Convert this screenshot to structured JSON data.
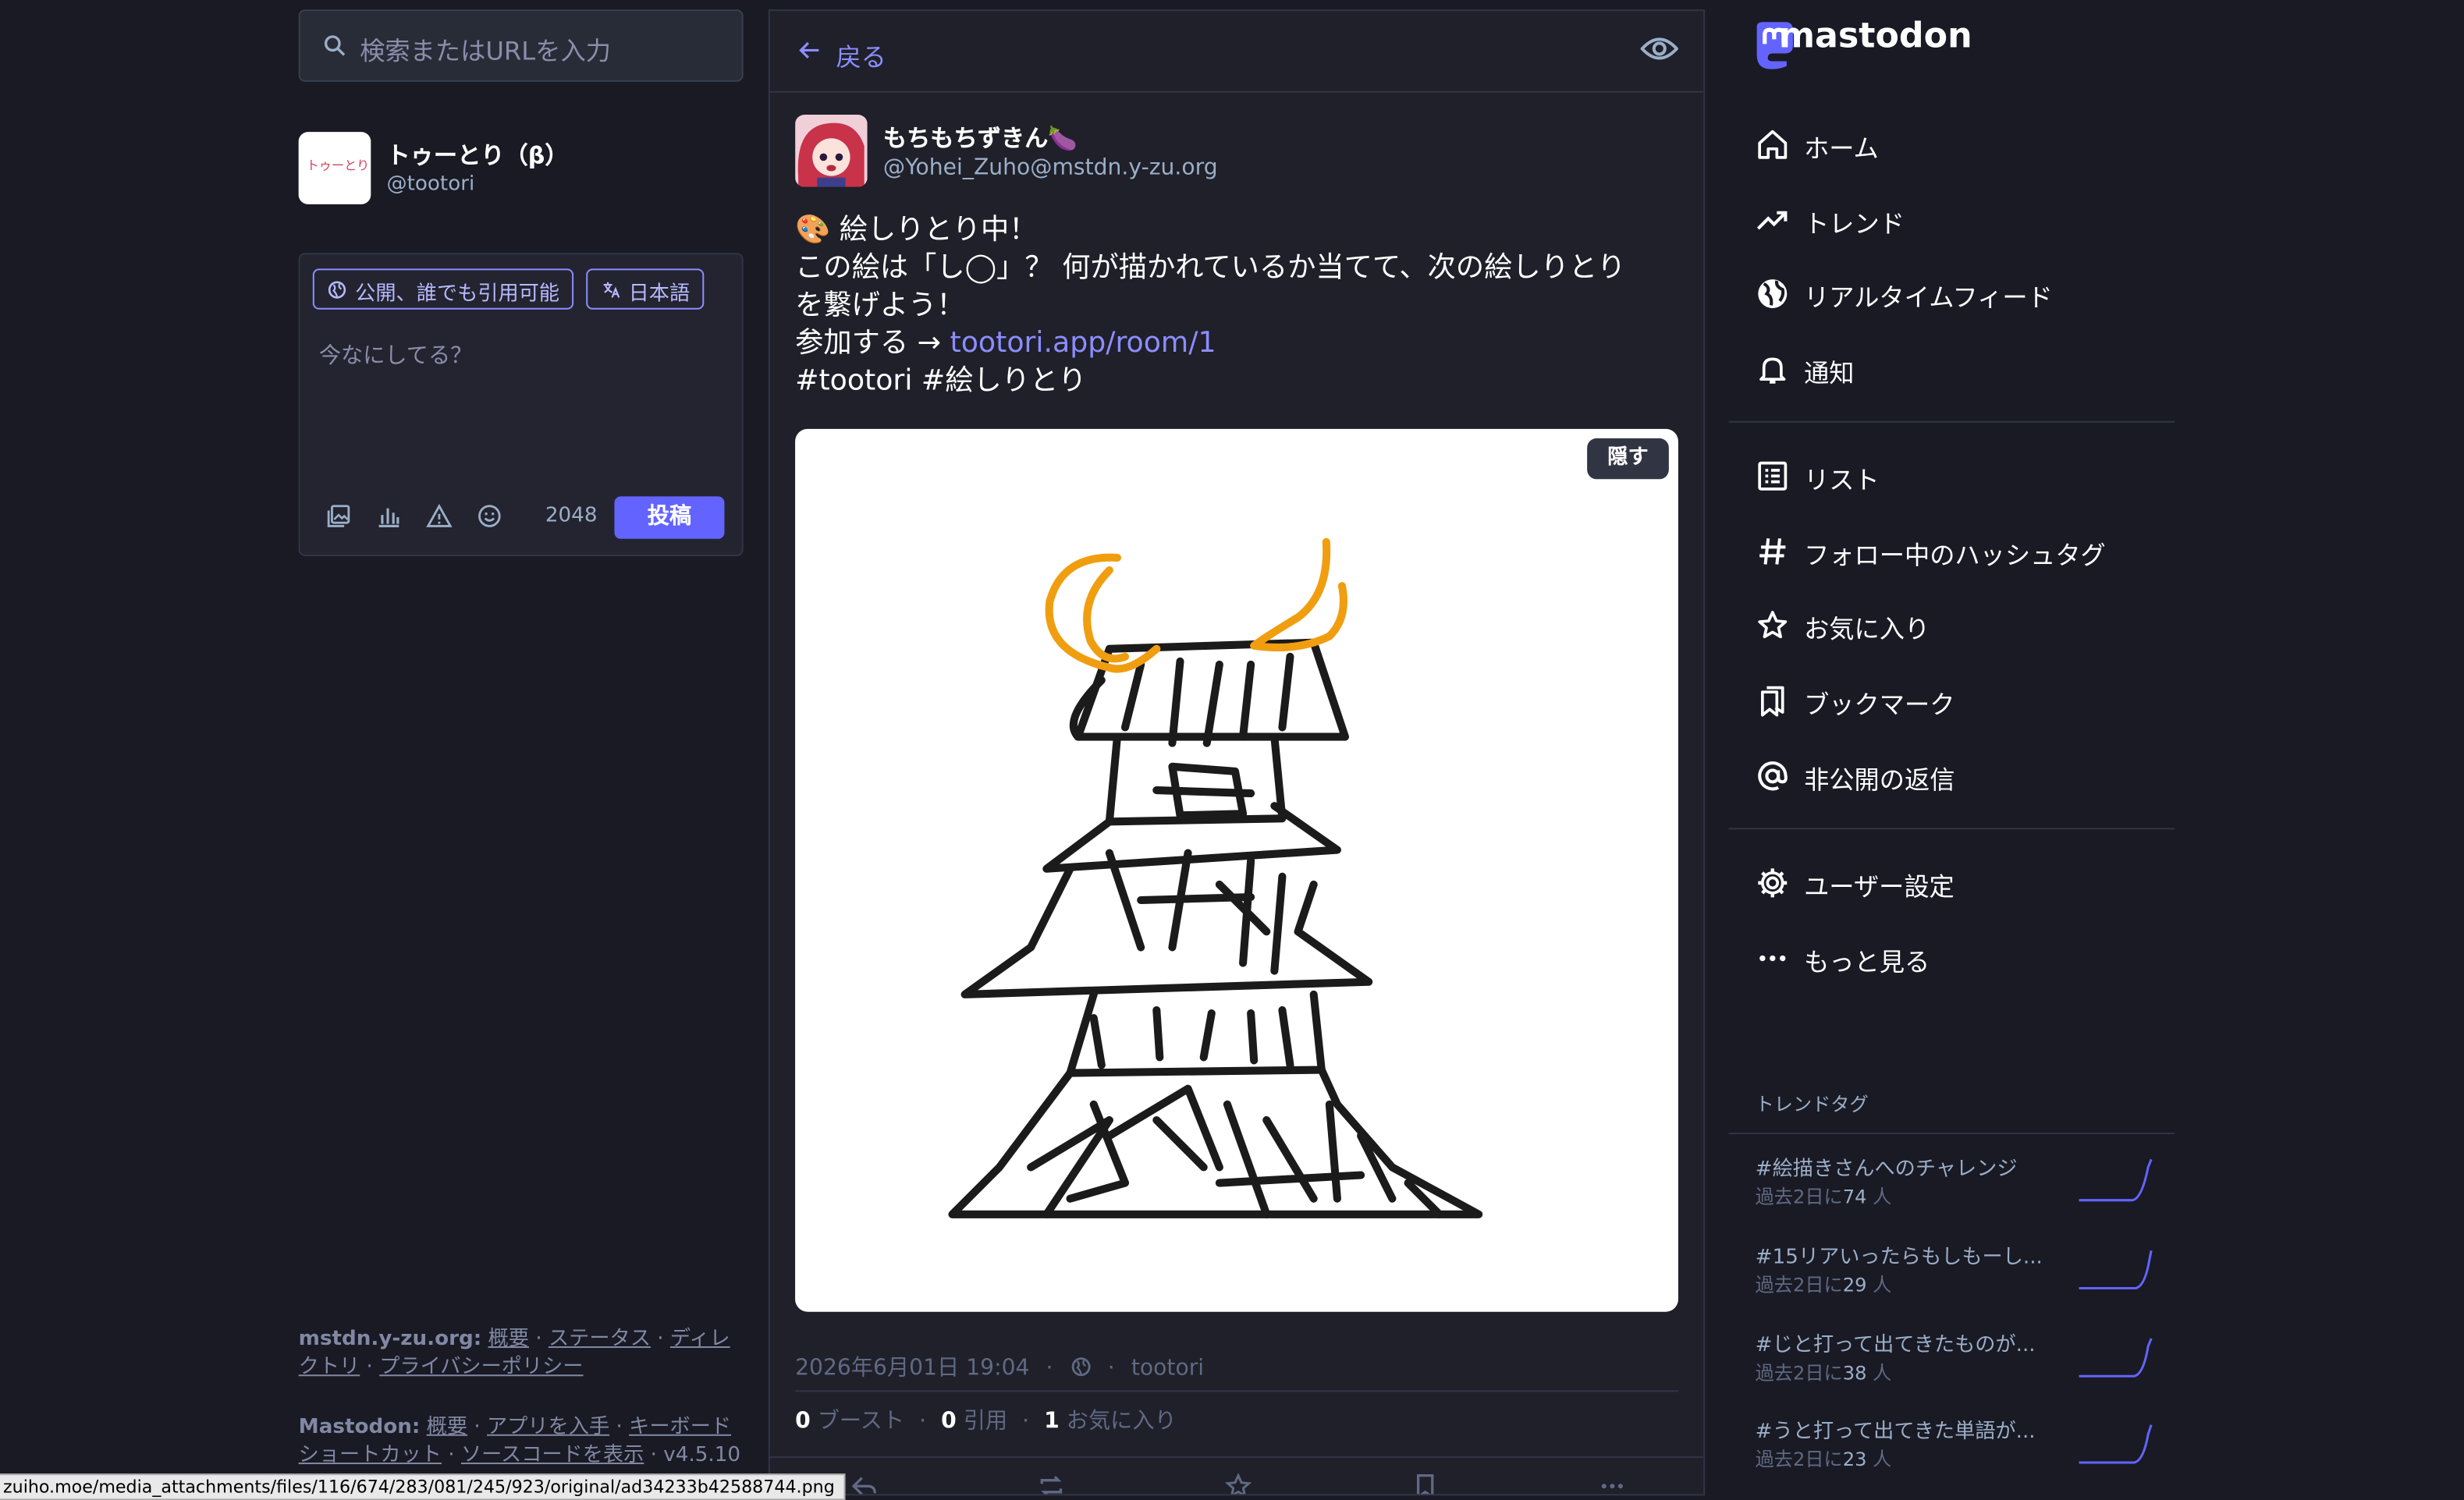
{
  "search": {
    "placeholder": "検索またはURLを入力"
  },
  "account": {
    "name": "トゥーとり（β）",
    "handle": "@tootori",
    "avatar_text": "トゥーとり"
  },
  "compose": {
    "visibility": "公開、誰でも引用可能",
    "language": "日本語",
    "placeholder": "今なにしてる？",
    "char_count": "2048",
    "submit": "投稿"
  },
  "footer": {
    "server": "mstdn.y-zu.org:",
    "server_links": [
      "概要",
      "ステータス",
      "ディレクトリ",
      "プライバシーポリシー"
    ],
    "mastodon": "Mastodon:",
    "mastodon_links": [
      "概要",
      "アプリを入手",
      "キーボードショートカット",
      "ソースコードを表示"
    ],
    "version": "v4.5.10"
  },
  "status_url": "zuiho.moe/media_attachments/files/116/674/283/081/245/923/original/ad34233b42588744.png",
  "column": {
    "back": "戻る"
  },
  "post": {
    "display_name": "もちもちずきん🍆",
    "handle": "@Yohei_Zuho@mstdn.y-zu.org",
    "lines": [
      "🎨 絵しりとり中！",
      "この絵は「し◯」？ 何が描かれているか当てて、次の絵しりとり",
      "を繋げよう！"
    ],
    "join_prefix": "参加する → ",
    "join_link": "tootori.app/room/1",
    "hashtags": "#tootori #絵しりとり",
    "hide": "隠す",
    "date": "2026年6月01日 19:04",
    "app": "tootori",
    "boosts": "0",
    "boosts_label": "ブースト",
    "quotes": "0",
    "quotes_label": "引用",
    "favs": "1",
    "favs_label": "お気に入り"
  },
  "brand": "mastodon",
  "nav": [
    {
      "label": "ホーム",
      "icon": "home-icon"
    },
    {
      "label": "トレンド",
      "icon": "trending-icon"
    },
    {
      "label": "リアルタイムフィード",
      "icon": "globe-icon"
    },
    {
      "label": "通知",
      "icon": "bell-icon"
    },
    {
      "label": "リスト",
      "icon": "list-icon"
    },
    {
      "label": "フォロー中のハッシュタグ",
      "icon": "hashtag-icon"
    },
    {
      "label": "お気に入り",
      "icon": "star-icon"
    },
    {
      "label": "ブックマーク",
      "icon": "bookmark-icon"
    },
    {
      "label": "非公開の返信",
      "icon": "at-icon"
    },
    {
      "label": "ユーザー設定",
      "icon": "gear-icon"
    },
    {
      "label": "もっと見る",
      "icon": "more-icon"
    }
  ],
  "trends": {
    "heading": "トレンドタグ",
    "items": [
      {
        "tag": "#絵描きさんへのチャレンジ",
        "prefix": "過去2日に",
        "count": "74",
        "suffix": " 人"
      },
      {
        "tag": "#15リアいったらもしもーし...",
        "prefix": "過去2日に",
        "count": "29",
        "suffix": " 人"
      },
      {
        "tag": "#じと打って出てきたものが...",
        "prefix": "過去2日に",
        "count": "38",
        "suffix": " 人"
      },
      {
        "tag": "#うと打って出てきた単語が...",
        "prefix": "過去2日に",
        "count": "23",
        "suffix": " 人"
      }
    ]
  },
  "colors": {
    "accent": "#6364ff",
    "link": "#8c8dff",
    "bg": "#191a24",
    "panel": "#1f2029"
  }
}
